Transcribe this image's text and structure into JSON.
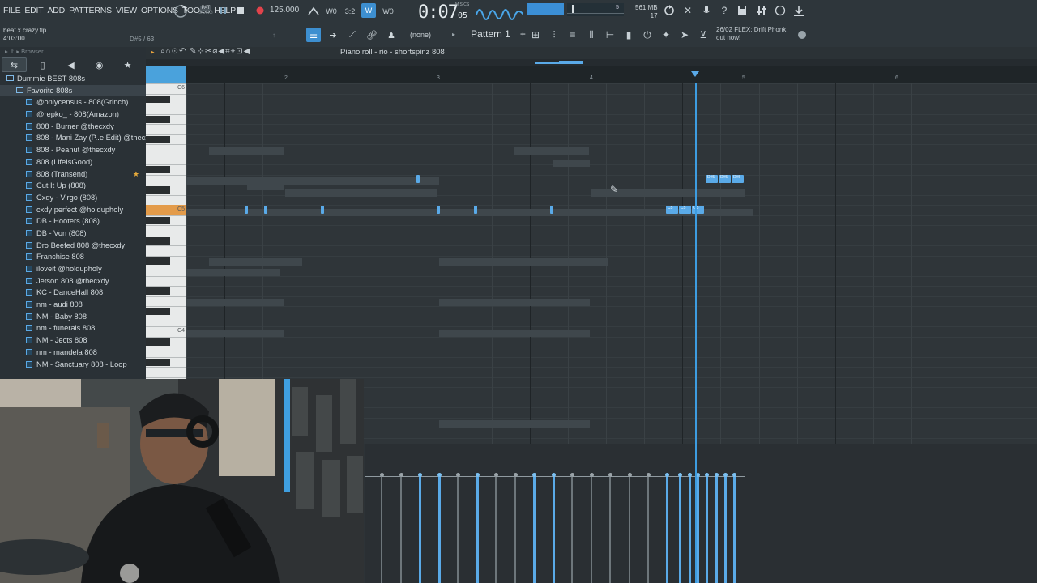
{
  "menu": [
    "FILE",
    "EDIT",
    "ADD",
    "PATTERNS",
    "VIEW",
    "OPTIONS",
    "TOOLS",
    "HELP"
  ],
  "project": {
    "name": "beat x crazy.flp",
    "position": "4:03:00",
    "hint_right": "D#5 / 63"
  },
  "transport": {
    "tempo": "125.000",
    "time": "0:07",
    "time_sub": "05",
    "time_mode": "M:S:CS",
    "cpu_ram": "561 MB",
    "voices": "17",
    "beats_label": "3:2",
    "none_label": "(none)",
    "pattern": "Pattern 1"
  },
  "news": {
    "line1": "26/02  FLEX: Drift Phonk",
    "line2": "out now!"
  },
  "browser": {
    "label": "Browser",
    "items": [
      {
        "label": "Dummie BEST 808s",
        "type": "folder",
        "level": 0
      },
      {
        "label": "Favorite 808s",
        "type": "folder",
        "level": 1
      },
      {
        "label": "@onlycensus - 808(Grinch)",
        "type": "file",
        "level": 2
      },
      {
        "label": "@repko_ - 808(Amazon)",
        "type": "file",
        "level": 2
      },
      {
        "label": "808 - Burner @thecxdy",
        "type": "file",
        "level": 2
      },
      {
        "label": "808 - Mani Zay (P..e Edit) @thecxdy",
        "type": "file",
        "level": 2
      },
      {
        "label": "808 - Peanut @thecxdy",
        "type": "file",
        "level": 2
      },
      {
        "label": "808 (LifeIsGood)",
        "type": "file",
        "level": 2
      },
      {
        "label": "808 (Transend)",
        "type": "file",
        "level": 2,
        "starred": true
      },
      {
        "label": "Cut It Up (808)",
        "type": "file",
        "level": 2
      },
      {
        "label": "Cxdy - Virgo (808)",
        "type": "file",
        "level": 2
      },
      {
        "label": "cxdy perfect @holdupholy",
        "type": "file",
        "level": 2
      },
      {
        "label": "DB - Hooters (808)",
        "type": "file",
        "level": 2
      },
      {
        "label": "DB - Von (808)",
        "type": "file",
        "level": 2
      },
      {
        "label": "Dro Beefed 808 @thecxdy",
        "type": "file",
        "level": 2
      },
      {
        "label": "Franchise 808",
        "type": "file",
        "level": 2
      },
      {
        "label": "iloveit @holdupholy",
        "type": "file",
        "level": 2
      },
      {
        "label": "Jetson 808 @thecxdy",
        "type": "file",
        "level": 2
      },
      {
        "label": "KC - DanceHall 808",
        "type": "file",
        "level": 2
      },
      {
        "label": "nm - audi 808",
        "type": "file",
        "level": 2
      },
      {
        "label": "NM - Baby 808",
        "type": "file",
        "level": 2
      },
      {
        "label": "nm - funerals 808",
        "type": "file",
        "level": 2
      },
      {
        "label": "NM - Jects 808",
        "type": "file",
        "level": 2
      },
      {
        "label": "nm - mandela 808",
        "type": "file",
        "level": 2
      },
      {
        "label": "NM - Sanctuary 808 - Loop",
        "type": "file",
        "level": 2
      }
    ]
  },
  "pianoroll": {
    "title": "Piano roll - rio - shortspinz 808",
    "bar_labels": [
      "2",
      "3",
      "4",
      "5",
      "6"
    ],
    "key_labels": [
      "C6",
      "C5",
      "C4"
    ],
    "note_labels": {
      "ds5": "D#5",
      "c5": "C5"
    }
  },
  "colors": {
    "accent": "#4aa2dc",
    "note": "#5aaae8",
    "bg": "#2d3337"
  }
}
